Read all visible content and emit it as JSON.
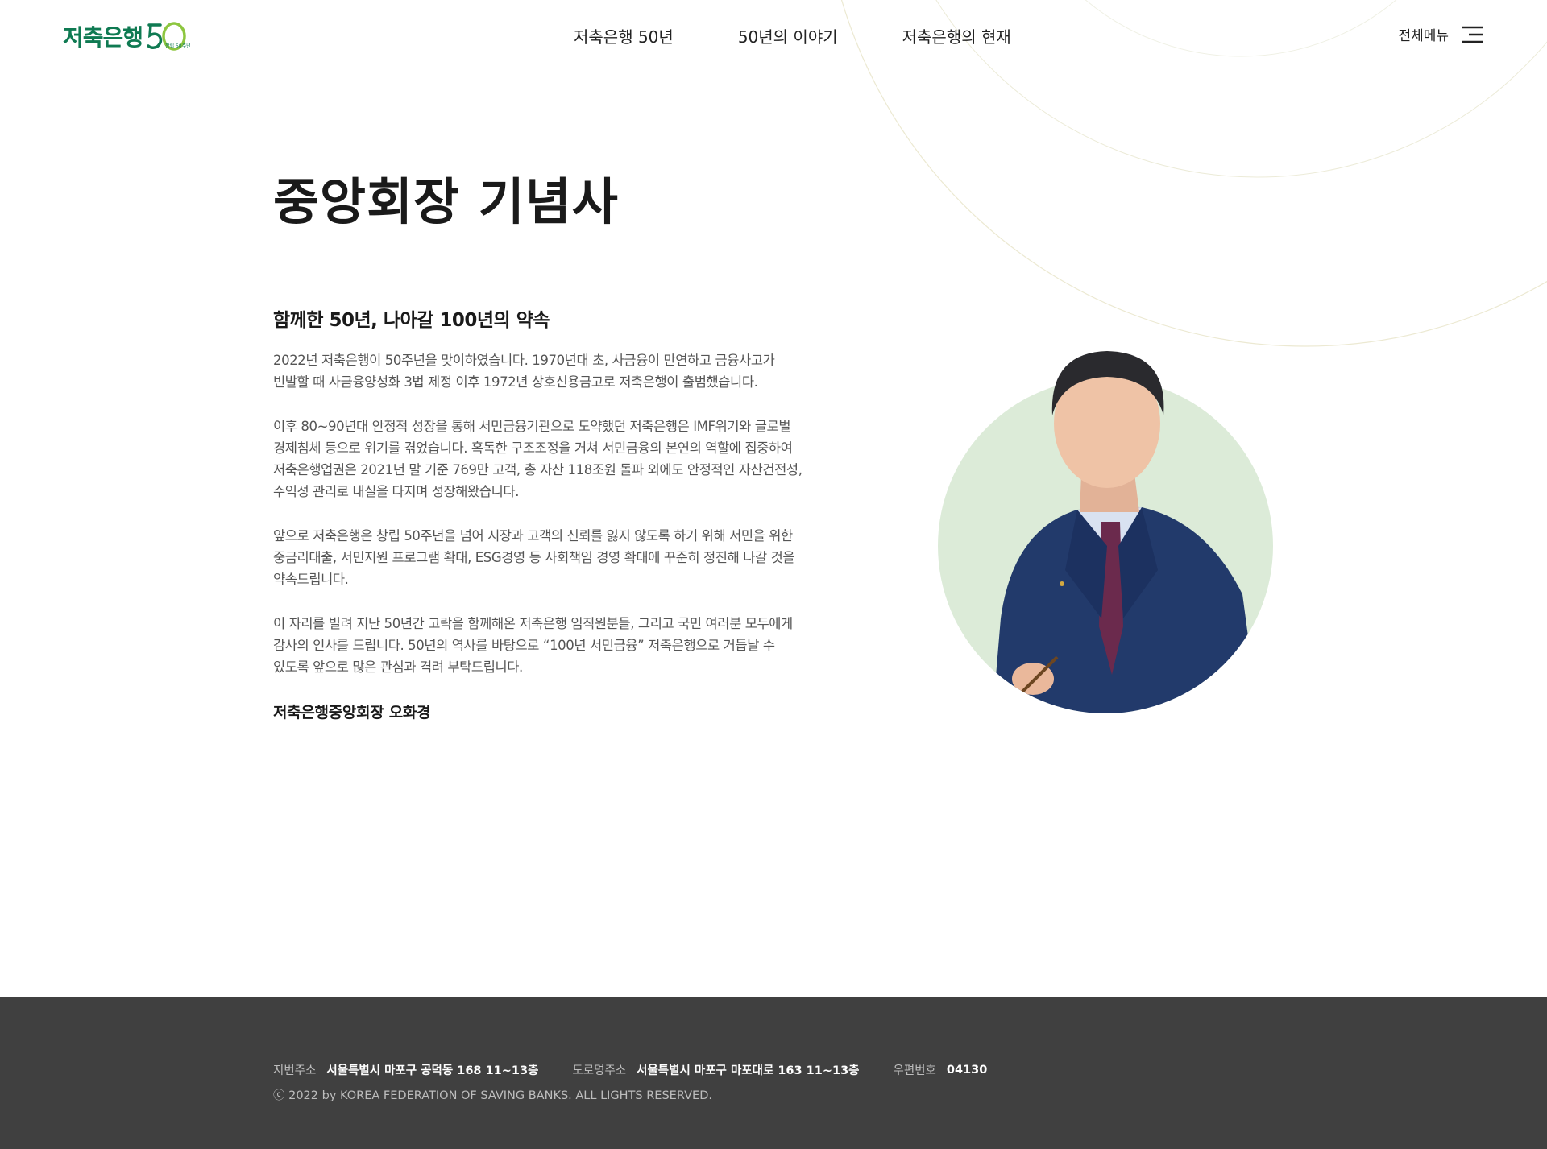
{
  "header": {
    "logo_text": "저축은행",
    "logo_number": "50",
    "logo_subtext": "창립 50주년",
    "nav": [
      {
        "label": "저축은행 50년"
      },
      {
        "label": "50년의 이야기"
      },
      {
        "label": "저축은행의 현재"
      }
    ],
    "menu_label": "전체메뉴"
  },
  "page": {
    "title": "중앙회장 기념사",
    "subtitle": "함께한 50년, 나아갈 100년의 약속",
    "paragraphs": [
      "2022년 저축은행이 50주년을 맞이하였습니다. 1970년대 초, 사금융이 만연하고 금융사고가\n빈발할 때 사금융양성화 3법 제정 이후 1972년 상호신용금고로 저축은행이 출범했습니다.",
      "이후 80~90년대 안정적 성장을 통해 서민금융기관으로 도약했던 저축은행은 IMF위기와 글로벌\n경제침체 등으로 위기를 겪었습니다. 혹독한 구조조정을 거쳐 서민금융의 본연의 역할에 집중하여\n저축은행업권은 2021년 말 기준 769만 고객, 총 자산 118조원 돌파 외에도 안정적인 자산건전성,\n수익성 관리로 내실을 다지며 성장해왔습니다.",
      "앞으로 저축은행은 창립 50주년을 넘어 시장과 고객의 신뢰를 잃지 않도록 하기 위해 서민을 위한\n중금리대출, 서민지원 프로그램 확대, ESG경영 등 사회책임 경영 확대에 꾸준히 정진해 나갈 것을\n약속드립니다.",
      "이 자리를 빌려 지난 50년간 고락을 함께해온 저축은행 임직원분들, 그리고 국민 여러분 모두에게\n감사의 인사를 드립니다. 50년의 역사를 바탕으로 “100년 서민금융” 저축은행으로 거듭날 수\n있도록 앞으로 많은 관심과 격려 부탁드립니다."
    ],
    "signature": "저축은행중앙회장 오화경"
  },
  "colors": {
    "brand_green": "#0f7a52",
    "accent_lime": "#8dc63f",
    "portrait_circle": "#dcebd8",
    "footer_bg": "#404040"
  },
  "icons": {
    "menu": "hamburger-icon",
    "portrait": "chairman-portrait"
  },
  "footer": {
    "address_items": [
      {
        "label": "지번주소",
        "value": "서울특별시 마포구 공덕동 168 11~13층"
      },
      {
        "label": "도로명주소",
        "value": "서울특별시 마포구 마포대로 163 11~13층"
      },
      {
        "label": "우편번호",
        "value": "04130"
      }
    ],
    "copyright": "ⓒ 2022 by KOREA FEDERATION OF SAVING BANKS. ALL LIGHTS RESERVED."
  }
}
